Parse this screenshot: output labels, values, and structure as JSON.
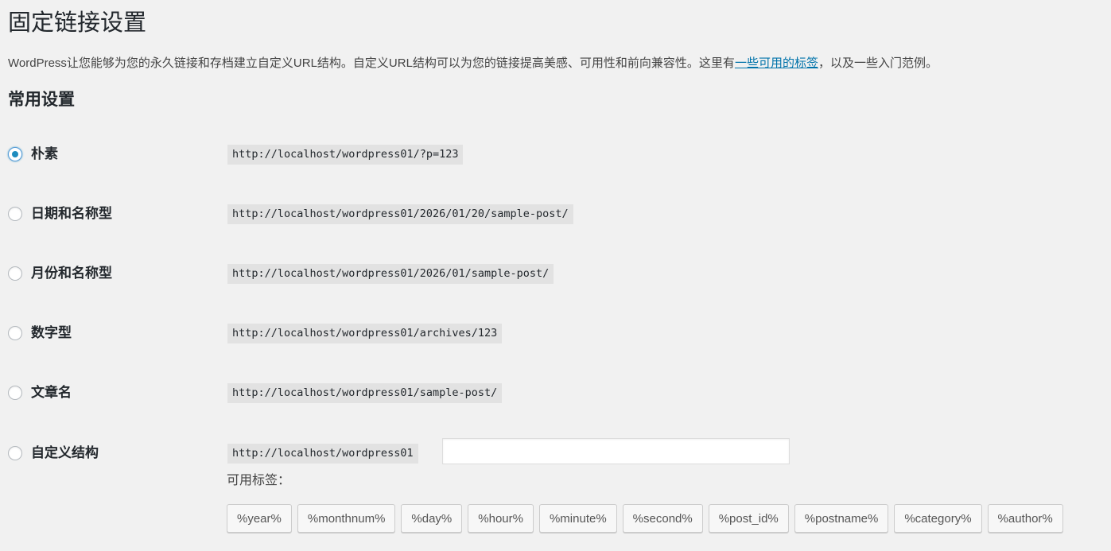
{
  "page": {
    "title": "固定链接设置",
    "intro_before_link": "WordPress让您能够为您的永久链接和存档建立自定义URL结构。自定义URL结构可以为您的链接提高美感、可用性和前向兼容性。这里有",
    "intro_link": "一些可用的标签",
    "intro_after_link": "，以及一些入门范例。",
    "section_title": "常用设置"
  },
  "options": [
    {
      "label": "朴素",
      "url": "http://localhost/wordpress01/?p=123",
      "checked": true
    },
    {
      "label": "日期和名称型",
      "url": "http://localhost/wordpress01/2026/01/20/sample-post/",
      "checked": false
    },
    {
      "label": "月份和名称型",
      "url": "http://localhost/wordpress01/2026/01/sample-post/",
      "checked": false
    },
    {
      "label": "数字型",
      "url": "http://localhost/wordpress01/archives/123",
      "checked": false
    },
    {
      "label": "文章名",
      "url": "http://localhost/wordpress01/sample-post/",
      "checked": false
    },
    {
      "label": "自定义结构",
      "url": "http://localhost/wordpress01",
      "checked": false
    }
  ],
  "custom": {
    "value": "",
    "tags_label": "可用标签：",
    "tags": [
      "%year%",
      "%monthnum%",
      "%day%",
      "%hour%",
      "%minute%",
      "%second%",
      "%post_id%",
      "%postname%",
      "%category%",
      "%author%"
    ]
  }
}
